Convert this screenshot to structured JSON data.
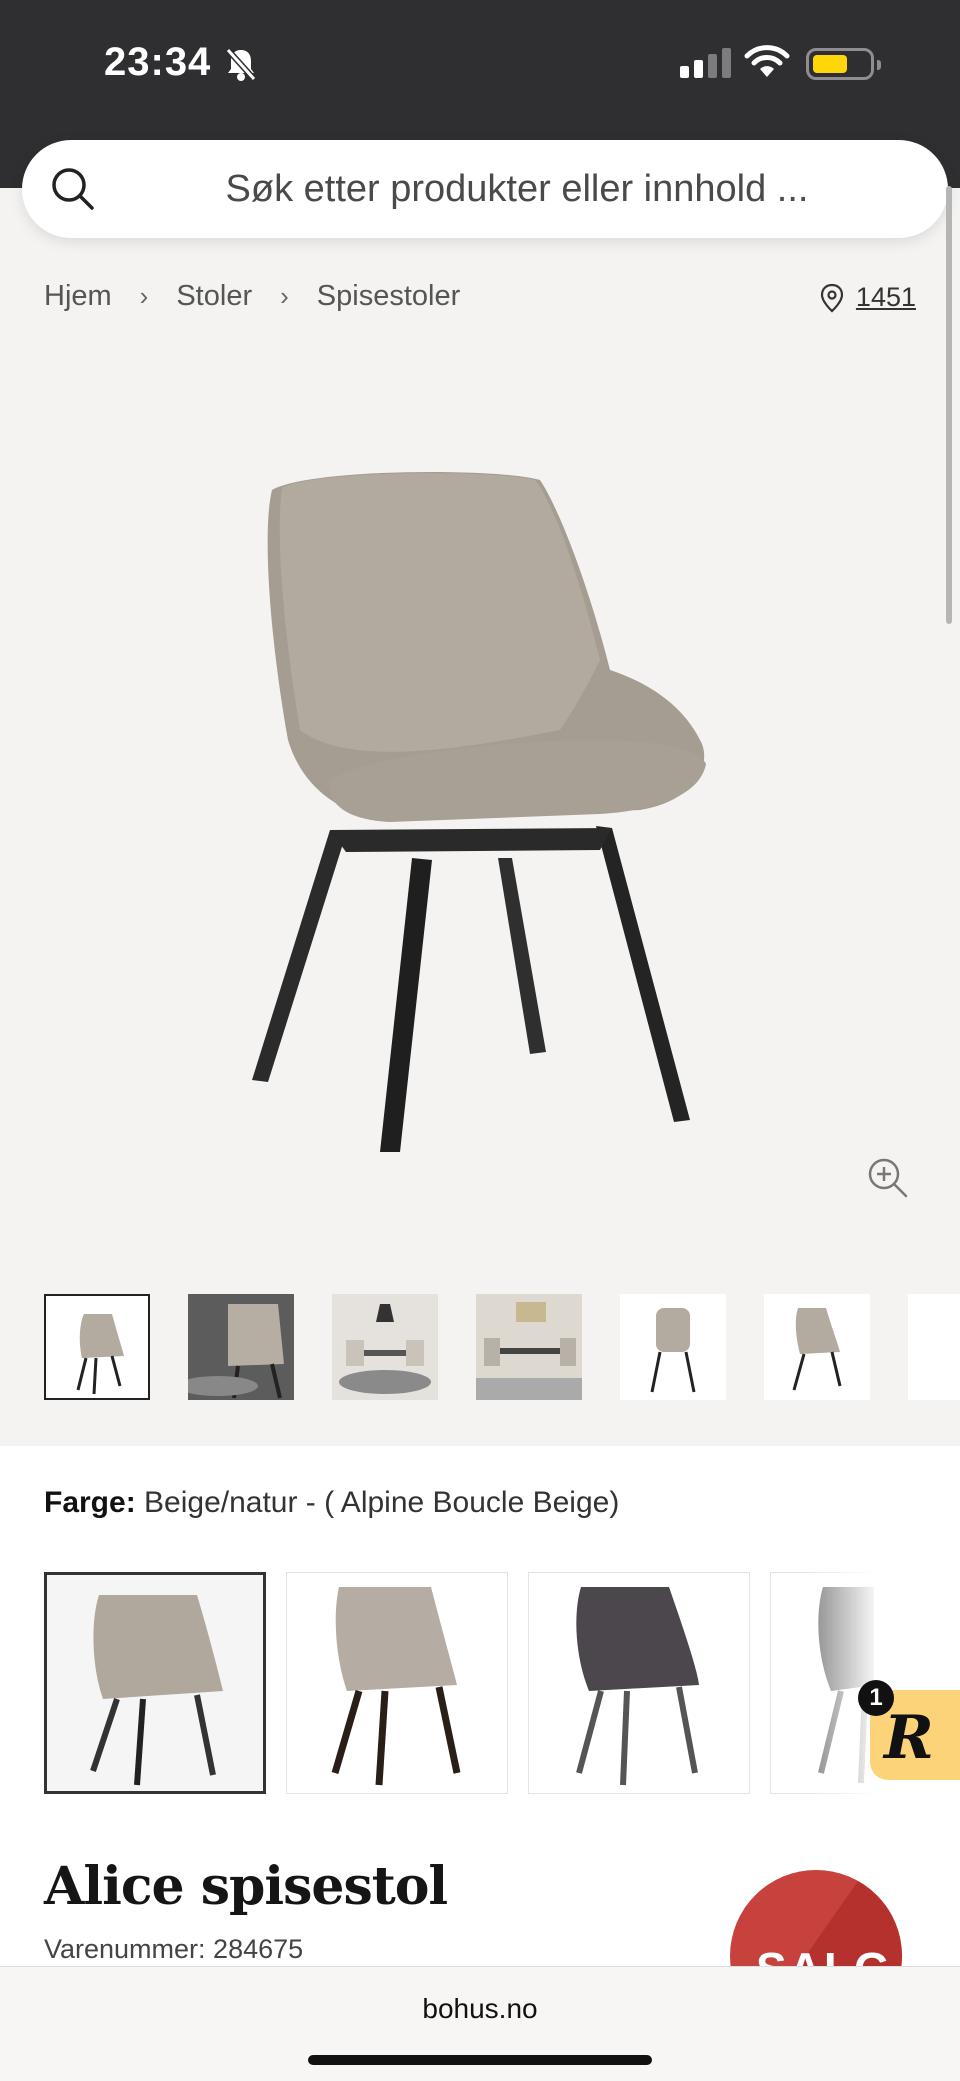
{
  "status_bar": {
    "time": "23:34"
  },
  "search": {
    "placeholder": "Søk etter produkter eller innhold ..."
  },
  "breadcrumb": {
    "items": [
      "Hjem",
      "Stoler",
      "Spisestoler"
    ]
  },
  "store": {
    "code": "1451"
  },
  "color_selector": {
    "label": "Farge:",
    "value": "Beige/natur - ( Alpine Boucle Beige)"
  },
  "chat_badge": {
    "count": "1",
    "letter": "R"
  },
  "product": {
    "title": "Alice spisestol",
    "sku": "Varenummer: 284675",
    "sale_label": "SALG"
  },
  "browser": {
    "url": "bohus.no"
  },
  "colors": {
    "accent_sale": "#c8423d",
    "chat_badge_bg": "#fdd37a",
    "status_bar_bg": "#2f2f32"
  }
}
